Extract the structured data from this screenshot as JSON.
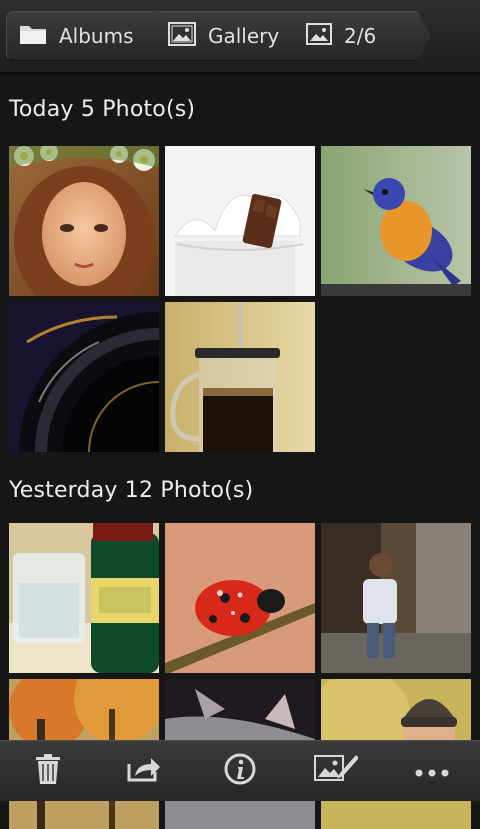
{
  "breadcrumb": {
    "albums_label": "Albums",
    "gallery_label": "Gallery",
    "position_label": "2/6"
  },
  "sections": [
    {
      "title": "Today 5 Photo(s)",
      "photos": [
        "girl-with-flower-crown",
        "milk-splash-chocolate",
        "blue-orange-bird",
        "camera-lens",
        "french-press-coffee"
      ]
    },
    {
      "title": "Yesterday 12 Photo(s)",
      "photos": [
        "glass-and-bottle",
        "ladybug-on-twig",
        "boy-walking",
        "autumn-trees",
        "cat",
        "woman-in-beanie"
      ]
    }
  ],
  "toolbar": {
    "icons": [
      "trash-icon",
      "share-icon",
      "info-icon",
      "edit-image-icon",
      "more-icon"
    ]
  },
  "colors": {
    "background": "#161616",
    "bar": "#2e2e2e",
    "text": "#e9e9e9"
  }
}
